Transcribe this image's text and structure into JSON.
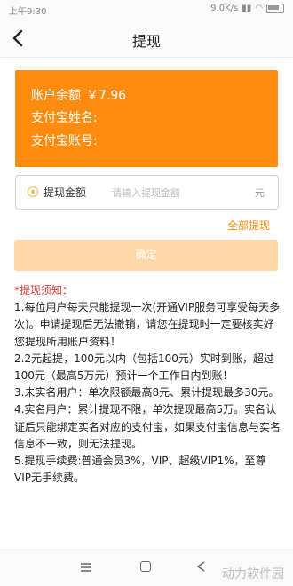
{
  "status": {
    "time": "上午9:30",
    "speed": "9.0K/s"
  },
  "header": {
    "title": "提现"
  },
  "account": {
    "balance_label": "账户余额",
    "balance_value": "￥7.96",
    "name_label": "支付宝姓名:",
    "account_label": "支付宝账号:"
  },
  "withdraw": {
    "label": "提现金额",
    "placeholder": "请输入提现金额",
    "unit": "元",
    "all_link": "全部提现",
    "confirm": "确定"
  },
  "notice": {
    "title": "*提现须知：",
    "items": [
      "1.每位用户每天只能提现一次(开通VIP服务可享受每天多次)。申请提现后无法撤销，请您在提现时一定要核实好您提现所用账户资料！",
      "2.2元起提，100元以内（包括100元）实时到账，超过100元（最高5万元）预计一个工作日内到账！",
      "3.未实名用户：单次限额最高8元、累计提现最多30元。",
      "4.实名用户：累计提现不限，单次提现最高5万。实名认证后只能绑定实名对应的支付宝，如果支付宝信息与实名信息不一致，则无法提现。",
      "5.提现手续费:普通会员3%，VIP、超级VIP1%，至尊VIP无手续费。"
    ]
  },
  "watermark": "动力软件园"
}
